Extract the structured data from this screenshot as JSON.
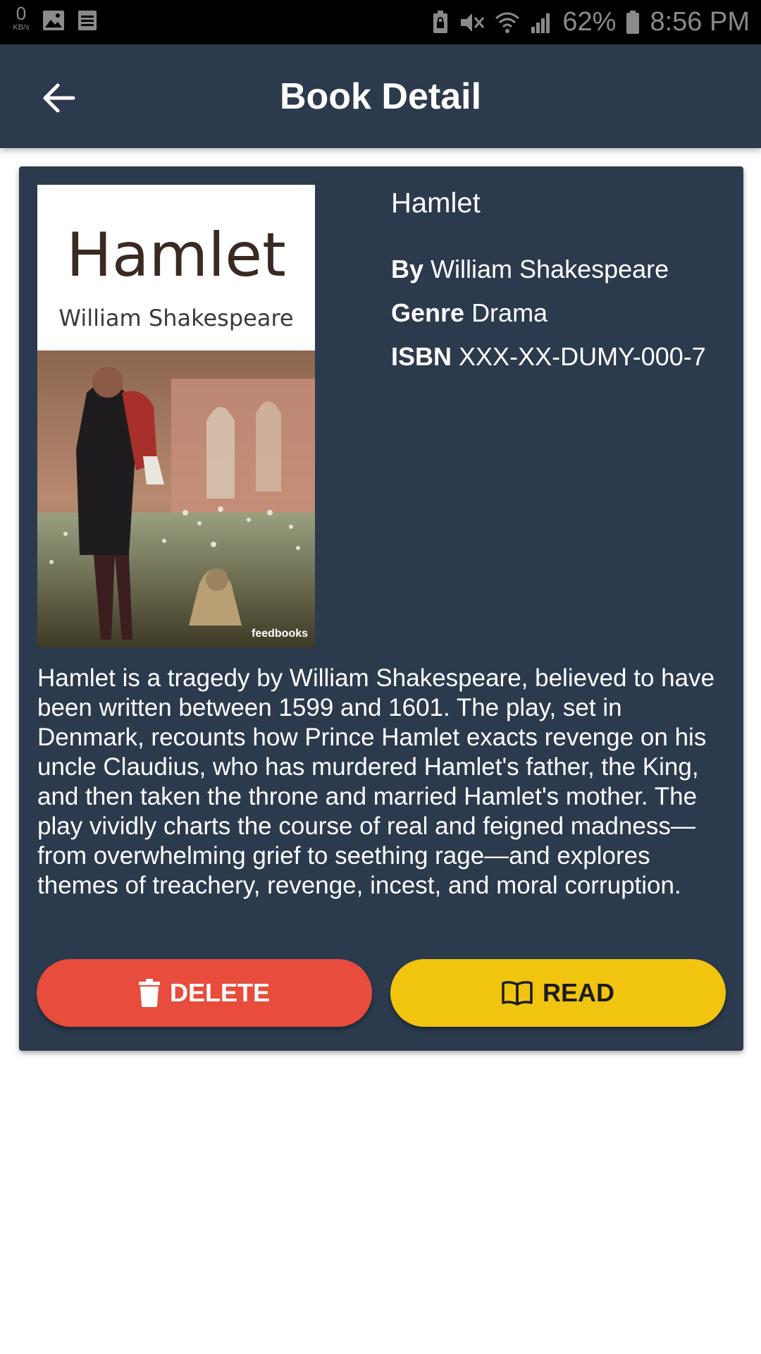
{
  "status_bar": {
    "net_speed": "0",
    "net_unit": "KB/s",
    "battery": "62%",
    "time": "8:56 PM",
    "left_icons": [
      "image-icon",
      "list-icon"
    ],
    "right_icons": [
      "lock-battery-icon",
      "mute-icon",
      "wifi-icon",
      "signal-icon",
      "battery-icon"
    ]
  },
  "app_bar": {
    "title": "Book Detail",
    "back_icon": "arrow-left-icon"
  },
  "book": {
    "cover": {
      "title": "Hamlet",
      "author": "William Shakespeare",
      "publisher": "feedbooks"
    },
    "title": "Hamlet",
    "by_label": "By",
    "author": "William Shakespeare",
    "genre_label": "Genre",
    "genre": "Drama",
    "isbn_label": "ISBN",
    "isbn": "XXX-XX-DUMY-000-7",
    "description": "Hamlet is a tragedy by William Shakespeare, believed to have been written between 1599 and 1601. The play, set in Denmark, recounts how Prince Hamlet exacts revenge on his uncle Claudius, who has murdered Hamlet's father, the King, and then taken the throne and married Hamlet's mother. The play vividly charts the course of real and feigned madness—from overwhelming grief to seething rage—and explores themes of treachery, revenge, incest, and moral corruption."
  },
  "actions": {
    "delete_label": "DELETE",
    "read_label": "READ"
  },
  "colors": {
    "app_bar": "#2c3a4e",
    "card": "#2c3a4e",
    "delete": "#e74c3c",
    "read": "#f1c40f"
  }
}
